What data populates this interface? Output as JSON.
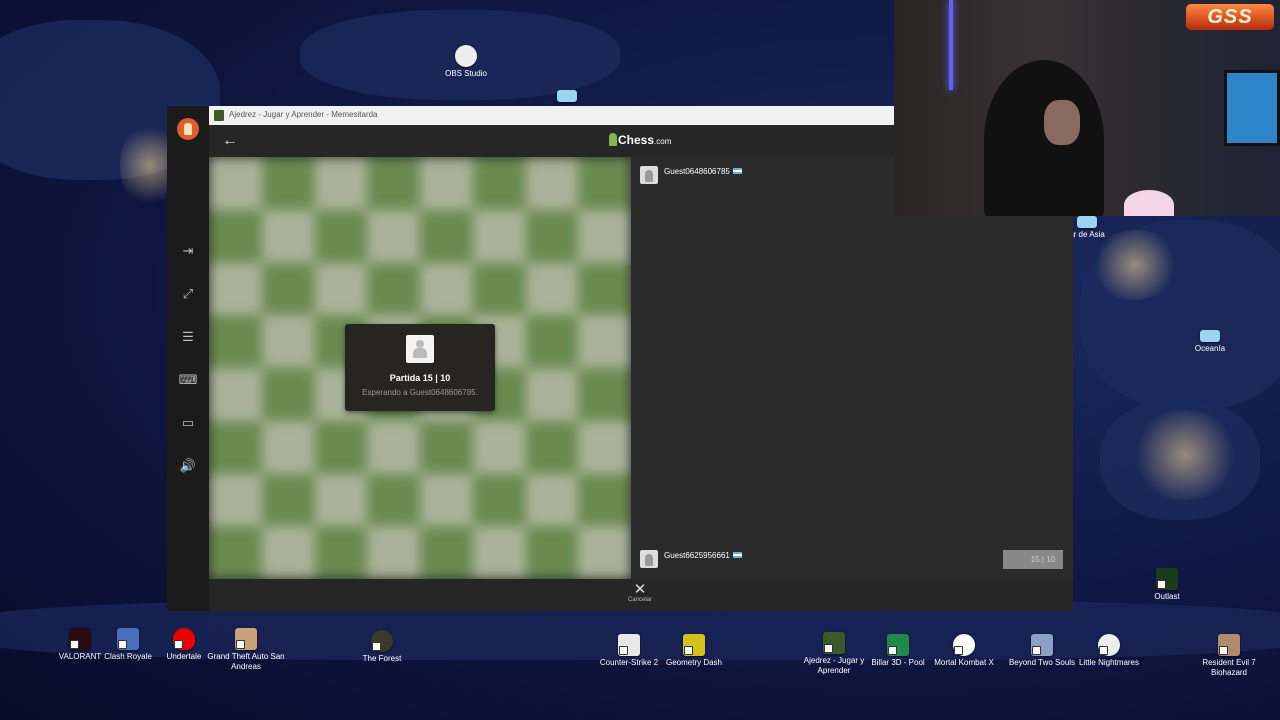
{
  "colors": {
    "accent_green": "#81b64c",
    "brand_logo": "#e2592d"
  },
  "window": {
    "title": "Ajedrez - Jugar y Aprender - Memesitarda"
  },
  "brand": {
    "name": "Chess",
    "suffix": ".com"
  },
  "game_modal": {
    "title": "Partida 15 | 10",
    "subtitle": "Esperando a Guest0648606785."
  },
  "players": {
    "top": {
      "name": "Guest0648606785",
      "flag": "argentina-flag-icon"
    },
    "bottom": {
      "name": "Guest6625956661",
      "flag": "argentina-flag-icon"
    }
  },
  "clock": {
    "value": "15 | 10"
  },
  "bottom_bar": {
    "cancel_label": "Cancelar"
  },
  "sidebar_icons": [
    "exit-icon",
    "resize-icon",
    "sliders-icon",
    "keyboard-icon",
    "tag-icon",
    "volume-icon"
  ],
  "overlay": {
    "logo_text": "GSS"
  },
  "desktop_icons": {
    "obs": "OBS Studio",
    "sur_asia": "ur de Asia",
    "oceania": "Oceanía",
    "outlast": "Outlast",
    "valorant": "VALORANT",
    "clash": "Clash Royale",
    "undertale": "Undertale",
    "gta": "Grand Theft Auto San Andreas",
    "forest": "The Forest",
    "cs2": "Counter-Strike 2",
    "gd": "Geometry Dash",
    "ajedrez": "Ajedrez - Jugar y Aprender",
    "billar": "Billar 3D - Pool",
    "mk": "Mortal Kombat X",
    "btwo": "Beyond Two Souls",
    "ln": "Little Nightmares",
    "re7": "Resident Evil 7 Biohazard"
  }
}
